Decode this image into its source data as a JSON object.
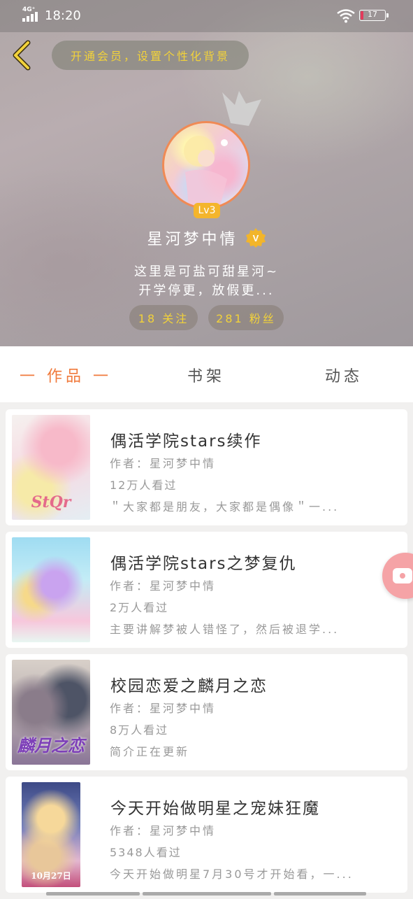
{
  "status_bar": {
    "network": "4G⁺",
    "time": "18:20",
    "battery": "17"
  },
  "header": {
    "vip_banner": "开通会员，设置个性化背景",
    "level": "Lv3",
    "nickname": "星河梦中情",
    "verified_badge": "V",
    "bio_line1": "这里是可盐可甜星河~",
    "bio_line2": "开学停更，放假更...",
    "following": "18 关注",
    "fans": "281 粉丝"
  },
  "tabs": {
    "works": "一 作品 一",
    "shelf": "书架",
    "feed": "动态"
  },
  "books": [
    {
      "title": "偶活学院stars续作",
      "author": "作者：星河梦中情",
      "views": "12万人看过",
      "desc": "＂大家都是朋友，大家都是偶像＂一...",
      "cover_text": "StQr"
    },
    {
      "title": "偶活学院stars之梦复仇",
      "author": "作者：星河梦中情",
      "views": "2万人看过",
      "desc": "主要讲解梦被人错怪了，然后被退学...",
      "cover_text": ""
    },
    {
      "title": "校园恋爱之麟月之恋",
      "author": "作者：星河梦中情",
      "views": "8万人看过",
      "desc": "简介正在更新",
      "cover_text": "麟月之恋"
    },
    {
      "title": "今天开始做明星之宠妹狂魔",
      "author": "作者：星河梦中情",
      "views": "5348人看过",
      "desc": "今天开始做明星7月30号才开始看，一...",
      "cover_text": "10月27日"
    }
  ],
  "colors": {
    "accent": "#f07a3c",
    "gold": "#f2d23a",
    "level_badge": "#f4b52c",
    "float_button": "#f5a3a6"
  },
  "icons": [
    "back-arrow-icon",
    "crown-icon",
    "verified-v-icon",
    "video-icon",
    "wifi-icon",
    "battery-icon",
    "signal-icon"
  ]
}
